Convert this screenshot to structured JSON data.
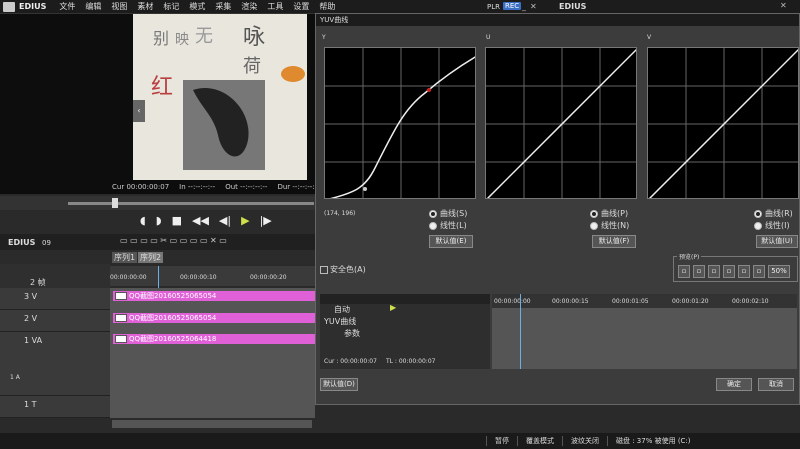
{
  "app": {
    "brand": "EDIUS",
    "plr": "PLR",
    "rec": "REC",
    "right_brand": "EDIUS"
  },
  "menu": [
    "文件",
    "编辑",
    "视图",
    "素材",
    "标记",
    "模式",
    "采集",
    "渲染",
    "工具",
    "设置",
    "帮助"
  ],
  "preview": {
    "timecodes": [
      {
        "label": "Cur",
        "value": "00:00:00:07"
      },
      {
        "label": "In",
        "value": "--:--:--:--"
      },
      {
        "label": "Out",
        "value": "--:--:--:--"
      },
      {
        "label": "Dur",
        "value": "--:--:--:--"
      }
    ]
  },
  "timeline": {
    "title": "EDIUS",
    "version": "09",
    "seq_tabs": [
      "序列1",
      "序列2"
    ],
    "ruler": [
      "00:00:00:00",
      "00:00:00:10",
      "00:00:00:20"
    ],
    "zoom": "2 帧",
    "tracks": [
      {
        "name": "3 V",
        "clip": "QQ截图20160525065054"
      },
      {
        "name": "2 V",
        "clip": "QQ截图20160525065054"
      },
      {
        "name": "1 VA",
        "clip": "QQ截图20160525064418"
      },
      {
        "name": "1 T",
        "clip": ""
      }
    ],
    "va_label": "1 A"
  },
  "dialog": {
    "title": "YUV曲线",
    "panels": [
      {
        "label": "Y",
        "coord": "(174, 196)",
        "opt1": "曲线(S)",
        "opt2": "线性(L)",
        "reset": "默认值(E)"
      },
      {
        "label": "U",
        "opt1": "曲线(P)",
        "opt2": "线性(N)",
        "reset": "默认值(F)"
      },
      {
        "label": "V",
        "opt1": "曲线(R)",
        "opt2": "线性(I)",
        "reset": "默认值(U)"
      }
    ],
    "safe_color": "安全色(A)",
    "preview_label": "预览(P)",
    "preview_pct": "50%",
    "kf_mode": "自动",
    "kf_ruler": [
      "00:00:00:00",
      "00:00:00:15",
      "00:00:01:05",
      "00:00:01:20",
      "00:00:02:10"
    ],
    "kf_tracks": [
      "YUV曲线",
      "参数"
    ],
    "kf_cur": "Cur : 00:00:00:07",
    "kf_tl": "TL : 00:00:00:07",
    "reset_all": "默认值(D)",
    "ok": "确定",
    "cancel": "取消"
  },
  "status": {
    "items": [
      "暂停",
      "覆盖模式",
      "波纹关闭",
      "磁盘 : 37% 被使用 (C:)"
    ]
  },
  "colors": {
    "clip": "#e060d8",
    "rec": "#3b6fc4",
    "curve_point": "#cc2222"
  }
}
